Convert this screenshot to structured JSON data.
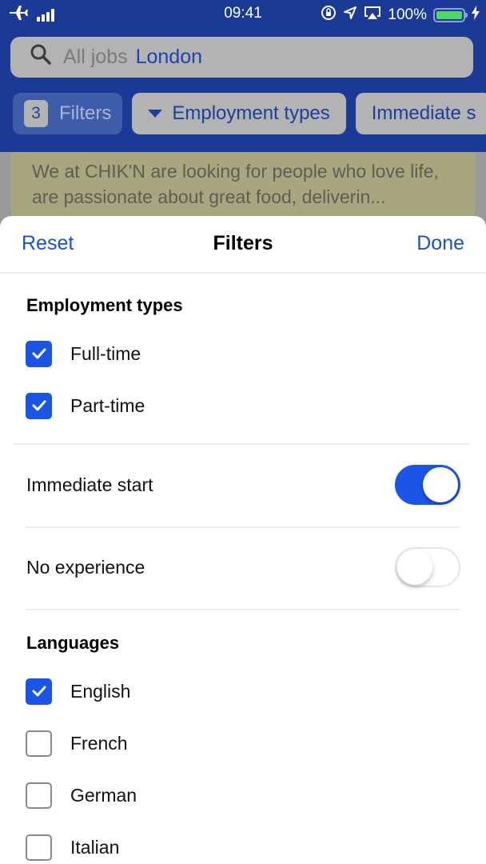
{
  "status_bar": {
    "time": "09:41",
    "battery_percent": "100%",
    "icons": [
      "airplane-icon",
      "signal-icon",
      "rotation-lock-icon",
      "location-icon",
      "airplay-icon",
      "battery-icon",
      "charging-icon"
    ]
  },
  "search": {
    "placeholder": "All jobs",
    "location": "London",
    "icon": "search-icon"
  },
  "chips": {
    "filters_count": "3",
    "filters_label": "Filters",
    "employment_types_label": "Employment types",
    "immediate_start_label": "Immediate s"
  },
  "background_card": {
    "description": "We  at CHIK'N are looking for people who love life, are passionate about great food, deliverin..."
  },
  "sheet": {
    "reset_label": "Reset",
    "title": "Filters",
    "done_label": "Done",
    "employment_types": {
      "title": "Employment types",
      "options": [
        {
          "label": "Full-time",
          "checked": true
        },
        {
          "label": "Part-time",
          "checked": true
        }
      ]
    },
    "toggles": [
      {
        "label": "Immediate start",
        "on": true
      },
      {
        "label": "No experience",
        "on": false
      }
    ],
    "languages": {
      "title": "Languages",
      "options": [
        {
          "label": "English",
          "checked": true
        },
        {
          "label": "French",
          "checked": false
        },
        {
          "label": "German",
          "checked": false
        },
        {
          "label": "Italian",
          "checked": false
        }
      ]
    }
  },
  "colors": {
    "header_bg": "#1a3a96",
    "accent": "#1a55e8",
    "link": "#1b4fd1"
  }
}
